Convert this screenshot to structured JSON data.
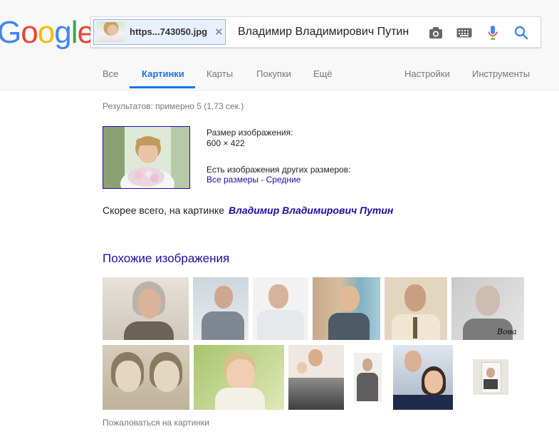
{
  "logo": {
    "text": "Google",
    "colors": [
      "#4285F4",
      "#EA4335",
      "#FBBC05",
      "#4285F4",
      "#34A853",
      "#EA4335"
    ]
  },
  "search": {
    "chip_filename": "https...743050.jpg",
    "query": "Владимир Владимирович Путин",
    "icons": [
      "camera-icon",
      "keyboard-icon",
      "mic-icon",
      "search-icon"
    ]
  },
  "tabs": {
    "all": "Все",
    "images": "Картинки",
    "maps": "Карты",
    "shopping": "Покупки",
    "more": "Ещё",
    "settings": "Настройки",
    "tools": "Инструменты",
    "active": "images"
  },
  "results": {
    "count": "Результатов: примерно 5 (1,73 сек.)",
    "size_label": "Размер изображения:",
    "size_value": "600 × 422",
    "other_sizes_label": "Есть изображения других размеров:",
    "other_sizes_links": "Все размеры - Средние",
    "best_guess_prefix": "Скорее всего, на картинке",
    "best_guess_link": "Владимир Владимирович Путин"
  },
  "similar": {
    "title": "Похожие изображения",
    "report": "Пожаловаться на картинки",
    "row1_caption_5": "Вова"
  },
  "colors": {
    "accent": "#1a73e8",
    "link": "#1a0dab",
    "muted": "#777777"
  }
}
